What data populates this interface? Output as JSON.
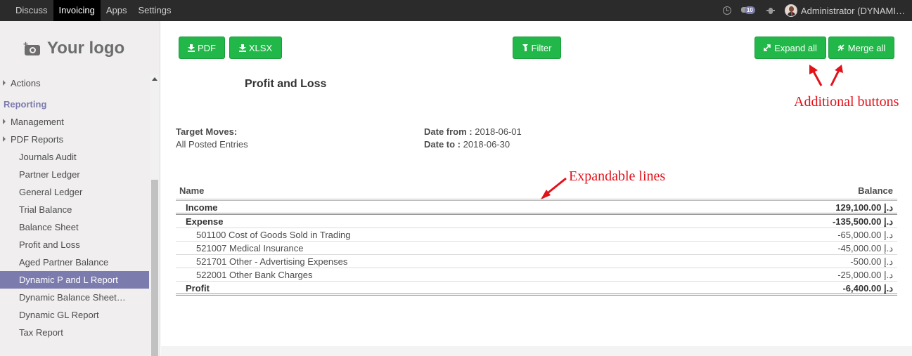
{
  "topbar": {
    "menu": [
      "Discuss",
      "Invoicing",
      "Apps",
      "Settings"
    ],
    "active_index": 1,
    "message_count": "10",
    "user": "Administrator (DYNAMI…",
    "icons": [
      "clock-icon",
      "chat-icon",
      "bug-icon",
      "user-avatar"
    ]
  },
  "sidebar": {
    "logo_text": "Your logo",
    "items": [
      {
        "label": "Actions",
        "kind": "top",
        "caret": true
      },
      {
        "label": "Reporting",
        "kind": "section"
      },
      {
        "label": "Management",
        "kind": "top",
        "caret": true
      },
      {
        "label": "PDF Reports",
        "kind": "top",
        "caret": true
      },
      {
        "label": "Journals Audit",
        "kind": "sub"
      },
      {
        "label": "Partner Ledger",
        "kind": "sub"
      },
      {
        "label": "General Ledger",
        "kind": "sub"
      },
      {
        "label": "Trial Balance",
        "kind": "sub"
      },
      {
        "label": "Balance Sheet",
        "kind": "sub"
      },
      {
        "label": "Profit and Loss",
        "kind": "sub"
      },
      {
        "label": "Aged Partner Balance",
        "kind": "sub"
      },
      {
        "label": "Dynamic P and L Report",
        "kind": "sub",
        "active": true
      },
      {
        "label": "Dynamic Balance Sheet…",
        "kind": "sub"
      },
      {
        "label": "Dynamic GL Report",
        "kind": "sub"
      },
      {
        "label": "Tax Report",
        "kind": "sub"
      }
    ]
  },
  "toolbar": {
    "pdf_label": "PDF",
    "xlsx_label": "XLSX",
    "filter_label": "Filter",
    "expand_label": "Expand all",
    "merge_label": "Merge all"
  },
  "report": {
    "title": "Profit and Loss",
    "target_moves_label": "Target Moves:",
    "target_moves_value": "All Posted Entries",
    "date_from_label": "Date from :",
    "date_from_value": "2018-06-01",
    "date_to_label": "Date to :",
    "date_to_value": "2018-06-30",
    "columns": {
      "name": "Name",
      "balance": "Balance"
    },
    "rows": [
      {
        "name": "Income",
        "balance": "129,100.00 د.إ",
        "level": 1,
        "bold": true,
        "double": true
      },
      {
        "name": "Expense",
        "balance": "-135,500.00 د.إ",
        "level": 1,
        "bold": true
      },
      {
        "name": "501100 Cost of Goods Sold in Trading",
        "balance": "-65,000.00 د.إ",
        "level": 2
      },
      {
        "name": "521007 Medical Insurance",
        "balance": "-45,000.00 د.إ",
        "level": 2
      },
      {
        "name": "521701 Other - Advertising Expenses",
        "balance": "-500.00 د.إ",
        "level": 2
      },
      {
        "name": "522001 Other Bank Charges",
        "balance": "-25,000.00 د.إ",
        "level": 2
      },
      {
        "name": "Profit",
        "balance": "-6,400.00 د.إ",
        "level": 1,
        "bold": true,
        "double": true
      }
    ]
  },
  "annotations": {
    "additional_buttons": "Additional buttons",
    "expandable_lines": "Expandable lines",
    "color": "#e3111a"
  },
  "colors": {
    "topbar": "#2b2b2b",
    "accent": "#7c7bad",
    "button": "#21b849"
  }
}
